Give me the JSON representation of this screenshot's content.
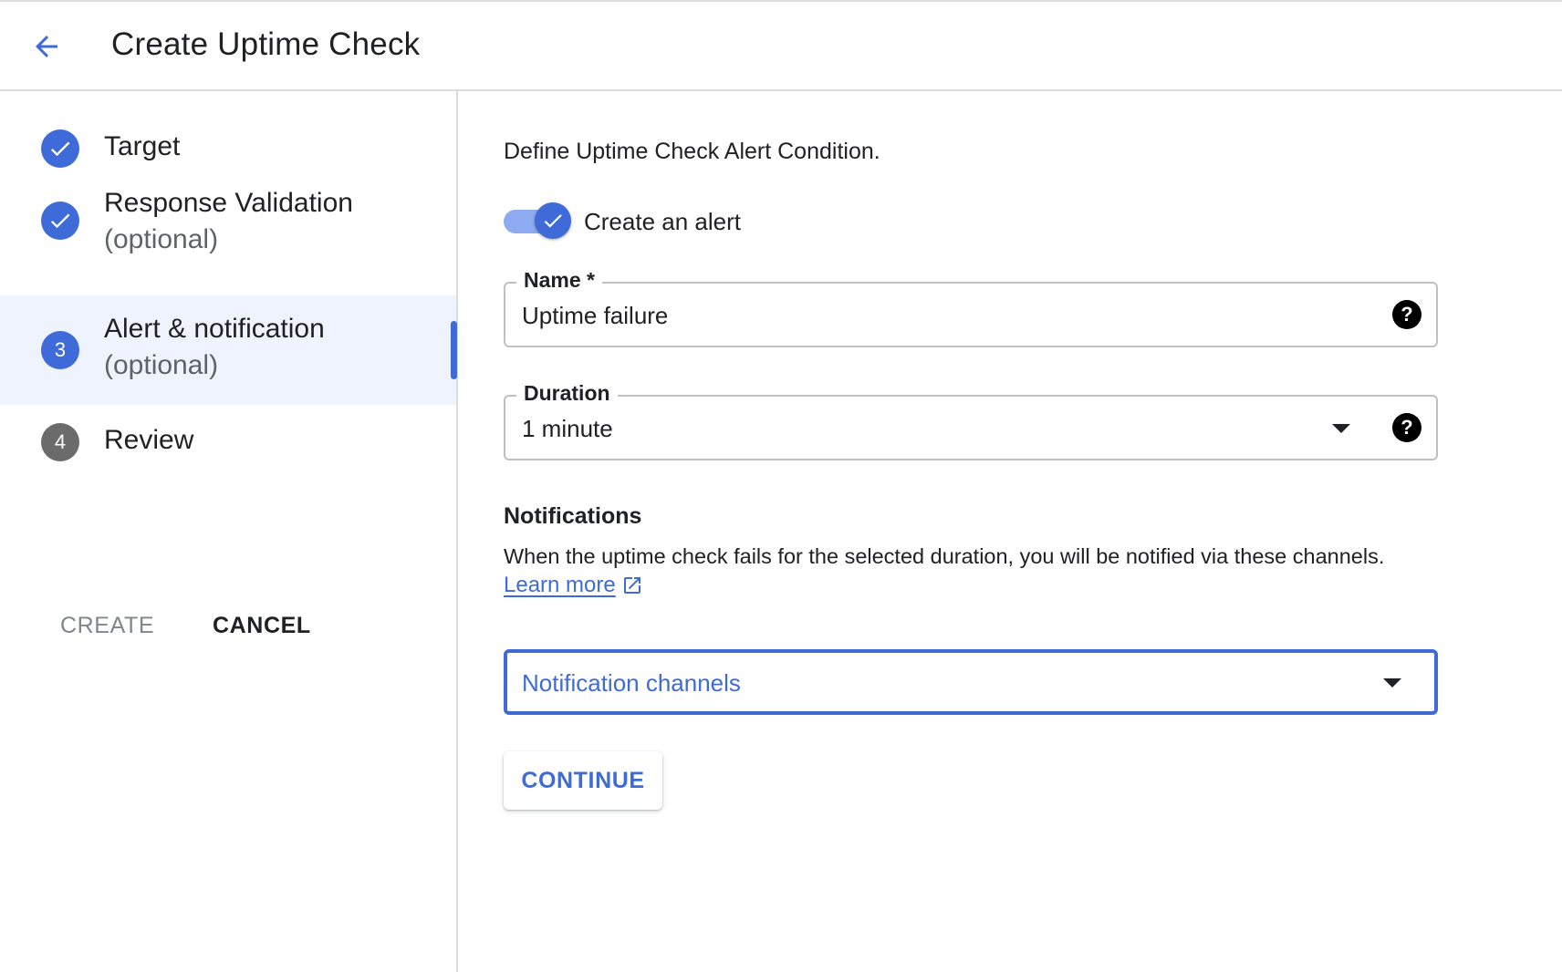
{
  "header": {
    "title": "Create Uptime Check",
    "back_icon": "arrow-back-icon"
  },
  "steps": [
    {
      "label": "Target",
      "sub": "",
      "state": "done"
    },
    {
      "label": "Response Validation",
      "sub": "(optional)",
      "state": "done"
    },
    {
      "label": "Alert & notification",
      "sub": "(optional)",
      "state": "current",
      "number": "3"
    },
    {
      "label": "Review",
      "sub": "",
      "state": "todo",
      "number": "4"
    }
  ],
  "sidebar_actions": {
    "create_label": "CREATE",
    "cancel_label": "CANCEL"
  },
  "main": {
    "intro": "Define Uptime Check Alert Condition.",
    "toggle": {
      "label": "Create an alert",
      "on": true
    },
    "name_field": {
      "label": "Name *",
      "value": "Uptime failure"
    },
    "duration_field": {
      "label": "Duration",
      "value": "1 minute"
    },
    "notifications": {
      "heading": "Notifications",
      "description": "When the uptime check fails for the selected duration, you will be notified via these channels.",
      "learn_more": "Learn more",
      "channels_placeholder": "Notification channels"
    },
    "continue_label": "CONTINUE"
  },
  "colors": {
    "accent": "#3f6bd8",
    "active_step_bg": "#eef3fd",
    "toggle_track": "#8eaaf0",
    "todo_badge": "#6b6b6b"
  }
}
